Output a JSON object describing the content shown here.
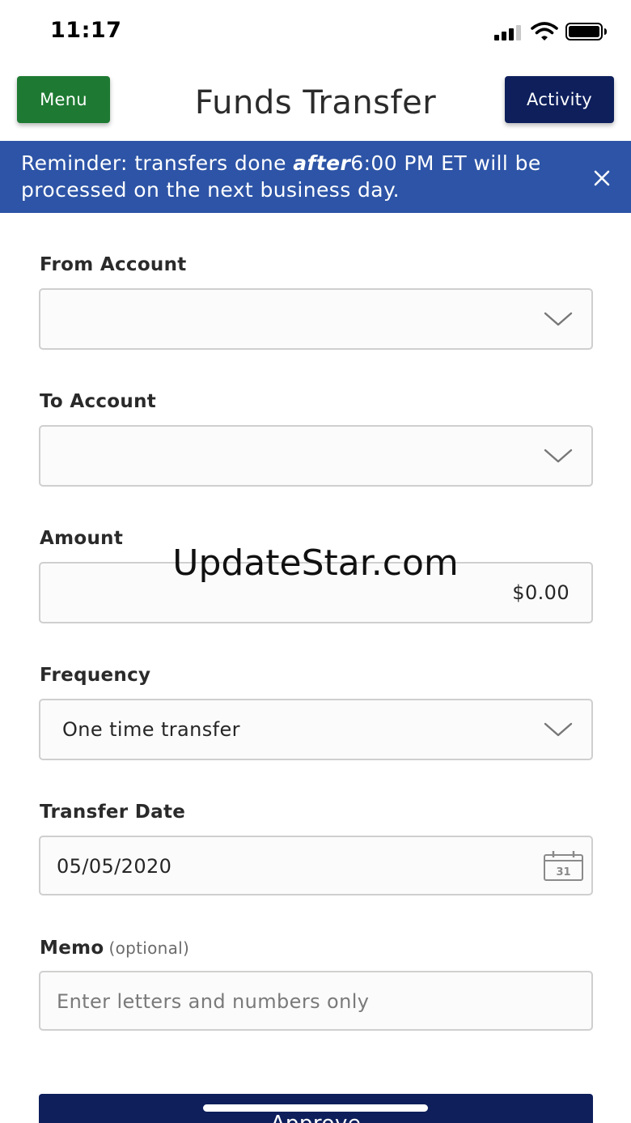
{
  "status_bar": {
    "time": "11:17"
  },
  "header": {
    "menu_label": "Menu",
    "title": "Funds Transfer",
    "activity_label": "Activity"
  },
  "banner": {
    "text_before": "Reminder: transfers done ",
    "text_emphasis": "after",
    "text_after": "6:00 PM ET will be processed on the next business day."
  },
  "form": {
    "from_account": {
      "label": "From Account",
      "value": ""
    },
    "to_account": {
      "label": "To Account",
      "value": ""
    },
    "amount": {
      "label": "Amount",
      "value": "$0.00"
    },
    "frequency": {
      "label": "Frequency",
      "value": "One time transfer"
    },
    "transfer_date": {
      "label": "Transfer Date",
      "value": "05/05/2020",
      "calendar_day": "31"
    },
    "memo": {
      "label": "Memo",
      "optional": "(optional)",
      "placeholder": "Enter letters and numbers only"
    }
  },
  "watermark": "UpdateStar.com",
  "approve_label": "Approve",
  "colors": {
    "menu_green": "#1e7a32",
    "navy": "#0e1f5c",
    "banner_blue": "#2d54a6"
  }
}
